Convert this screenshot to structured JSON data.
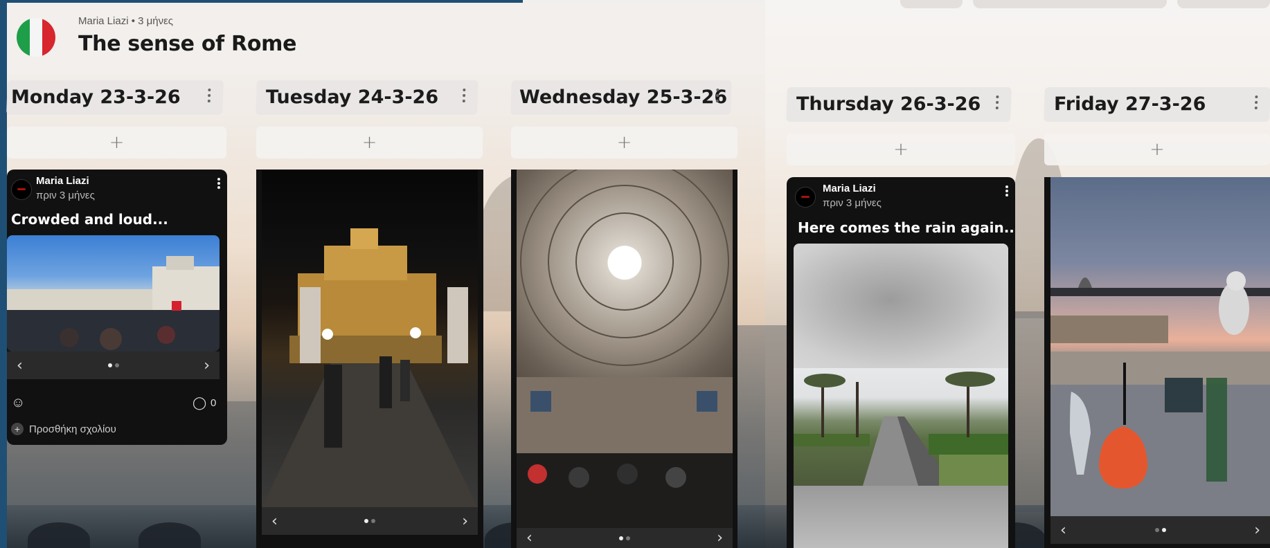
{
  "board": {
    "author_meta": "Maria Liazi • 3 μήνες",
    "title": "The sense of Rome",
    "flag_colors": [
      "#1f9e4a",
      "#f5f5f5",
      "#d7262e"
    ]
  },
  "columns": [
    {
      "title": "Monday 23-3-26",
      "add_label": "+"
    },
    {
      "title": "Tuesday 24-3-26",
      "add_label": "+"
    },
    {
      "title": "Wednesday 25-3-26",
      "add_label": "+"
    },
    {
      "title": "Thursday 26-3-26",
      "add_label": "+"
    },
    {
      "title": "Friday 27-3-26",
      "add_label": "+"
    }
  ],
  "posts": {
    "monday": {
      "author": "Maria Liazi",
      "time_ago": "πριν 3 μήνες",
      "title": "Crowded and loud...",
      "carousel": {
        "prev": "‹",
        "next": "›",
        "slide_count": 2,
        "active_slide": 1
      },
      "comments_count": "0",
      "add_comment_label": "Προσθήκη σχολίου"
    },
    "tuesday": {
      "carousel": {
        "prev": "‹",
        "next": "›",
        "slide_count": 2,
        "active_slide": 1
      }
    },
    "wednesday": {
      "carousel": {
        "prev": "‹",
        "next": "›",
        "slide_count": 2,
        "active_slide": 1
      }
    },
    "thursday": {
      "author": "Maria Liazi",
      "time_ago": "πριν 3 μήνες",
      "title": "Here comes the rain again..."
    },
    "friday": {
      "carousel": {
        "prev": "‹",
        "next": "›",
        "slide_count": 2,
        "active_slide": 2
      }
    }
  },
  "icons": {
    "column_menu": "kebab-vertical-icon",
    "add": "plus-icon",
    "reaction": "add-reaction-icon",
    "comment": "comment-bubble-icon"
  }
}
